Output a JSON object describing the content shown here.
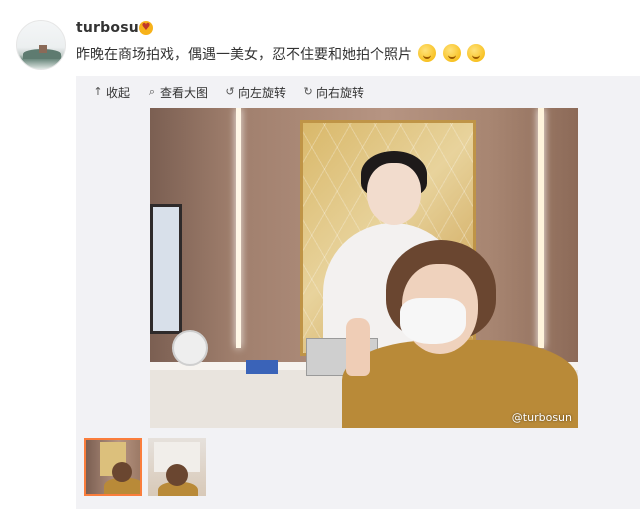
{
  "user": {
    "name": "turbosun",
    "badge_icon": "smile-heart-eyes-icon"
  },
  "post": {
    "text": "昨晚在商场拍戏，偶遇一美女，忍不住要和她拍个照片",
    "emoji_icons": [
      "doge-face-icon",
      "doge-face-icon",
      "doge-face-icon"
    ]
  },
  "toolbar": {
    "collapse_label": "收起",
    "view_large_label": "查看大图",
    "rotate_left_label": "向左旋转",
    "rotate_right_label": "向右旋转"
  },
  "photo": {
    "watermark": "@turbosun"
  },
  "thumbnails": {
    "count": 2,
    "active_index": 0
  },
  "colors": {
    "active_thumb_border": "#fa7d3c",
    "media_bg": "#f2f2f5"
  }
}
